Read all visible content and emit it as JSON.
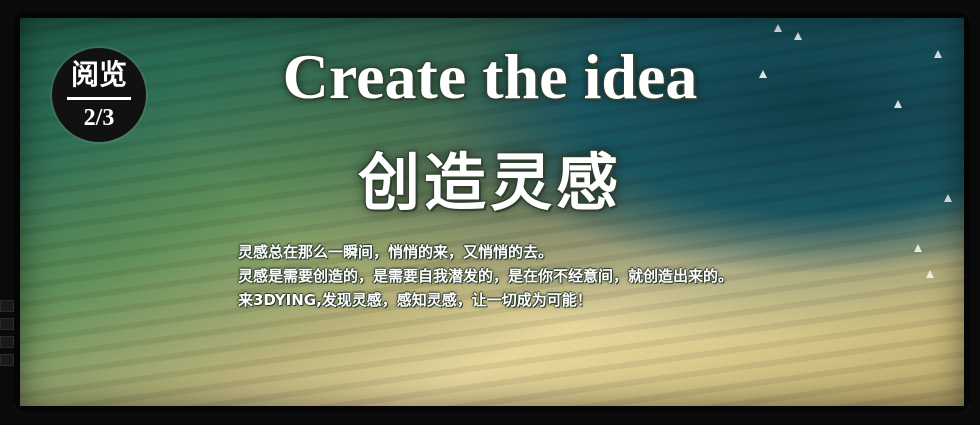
{
  "badge": {
    "label": "阅览",
    "page": "2/3"
  },
  "banner": {
    "title_en": "Create the idea",
    "title_zh": "创造灵感",
    "lines": [
      "灵感总在那么一瞬间，悄悄的来，又悄悄的去。",
      "灵感是需要创造的，是需要自我潜发的，是在你不经意间，就创造出来的。",
      "来3DYING,发现灵感，感知灵感，让一切成为可能！"
    ]
  }
}
